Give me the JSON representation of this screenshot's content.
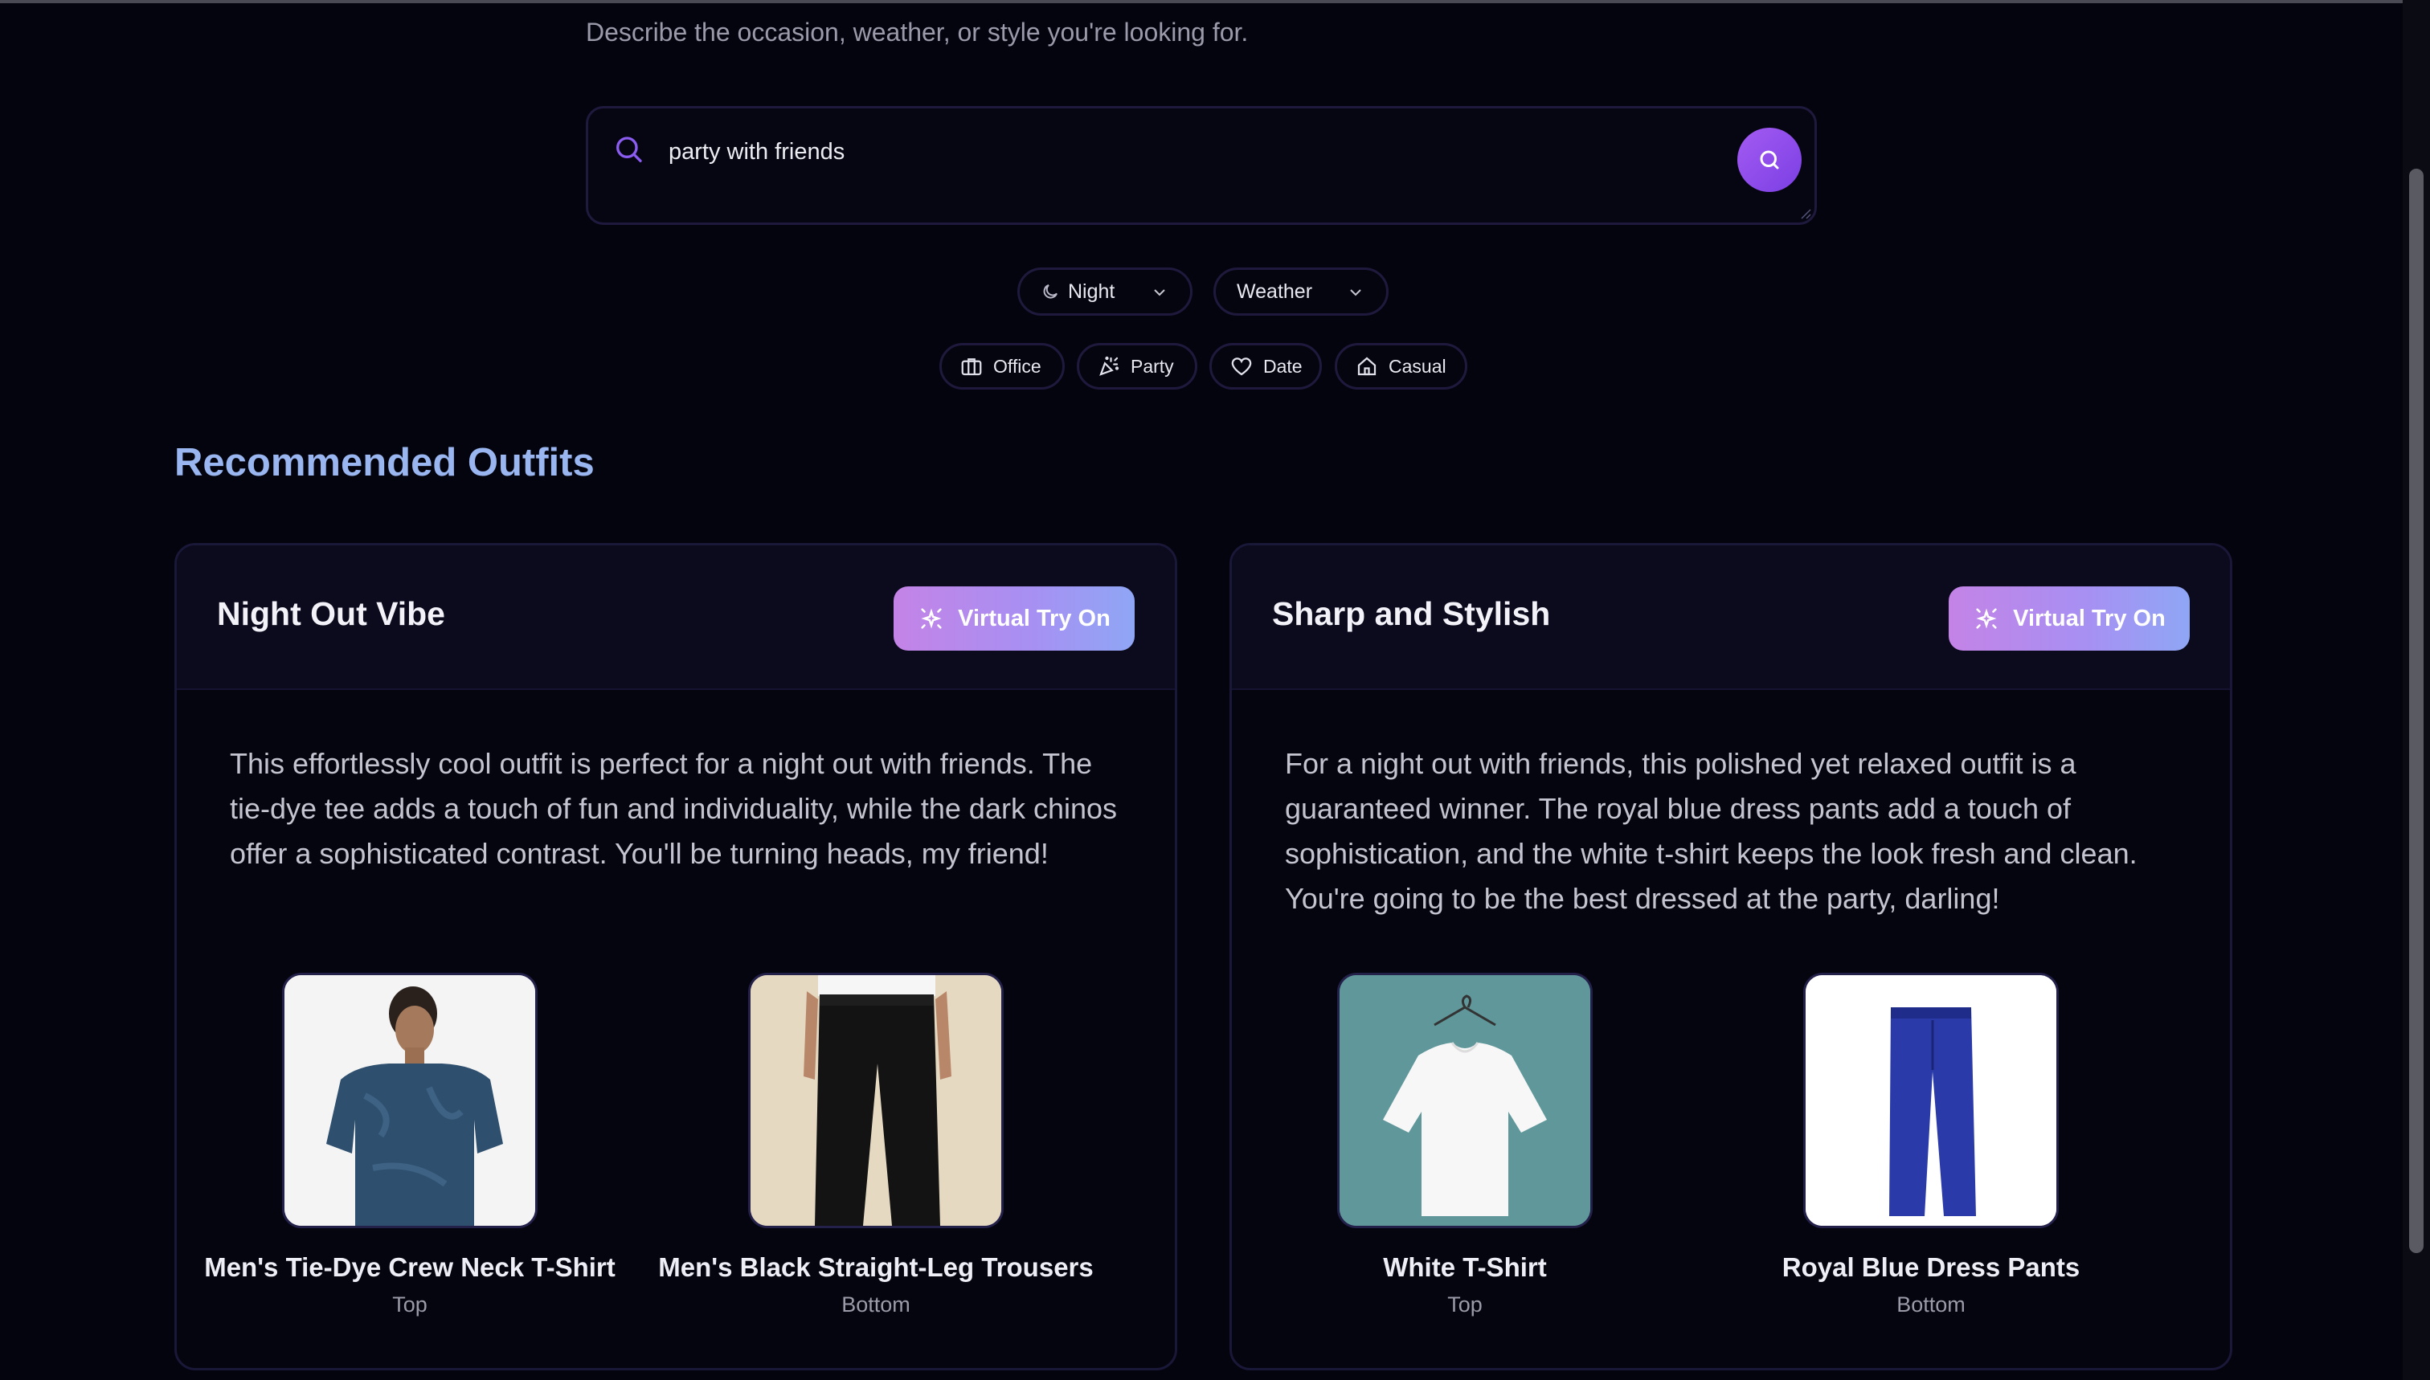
{
  "header": {
    "subtitle": "Describe the occasion, weather, or style you're looking for."
  },
  "search": {
    "value": "party with friends"
  },
  "filters": {
    "time": {
      "label": "Night",
      "icon": "moon-icon"
    },
    "weather": {
      "label": "Weather"
    }
  },
  "occasions": [
    {
      "label": "Office",
      "icon": "briefcase-icon"
    },
    {
      "label": "Party",
      "icon": "party-popper-icon"
    },
    {
      "label": "Date",
      "icon": "heart-icon"
    },
    {
      "label": "Casual",
      "icon": "home-icon"
    }
  ],
  "recommendations": {
    "title": "Recommended Outfits",
    "try_on_label": "Virtual Try On",
    "outfits": [
      {
        "title": "Night Out Vibe",
        "description": "This effortlessly cool outfit is perfect for a night out with friends. The tie-dye tee adds a touch of fun and individuality, while the dark chinos offer a sophisticated contrast. You'll be turning heads, my friend!",
        "items": [
          {
            "name": "Men's Tie-Dye Crew Neck T-Shirt",
            "type": "Top"
          },
          {
            "name": "Men's Black Straight-Leg Trousers",
            "type": "Bottom"
          }
        ]
      },
      {
        "title": "Sharp and Stylish",
        "description": "For a night out with friends, this polished yet relaxed outfit is a guaranteed winner. The royal blue dress pants add a touch of sophistication, and the white t-shirt keeps the look fresh and clean. You're going to be the best dressed at the party, darling!",
        "items": [
          {
            "name": "White T-Shirt",
            "type": "Top"
          },
          {
            "name": "Royal Blue Dress Pants",
            "type": "Bottom"
          }
        ]
      }
    ]
  },
  "colors": {
    "background": "#04040f",
    "accent": "#9b5cf0",
    "section_title": "#9ab6f0"
  }
}
